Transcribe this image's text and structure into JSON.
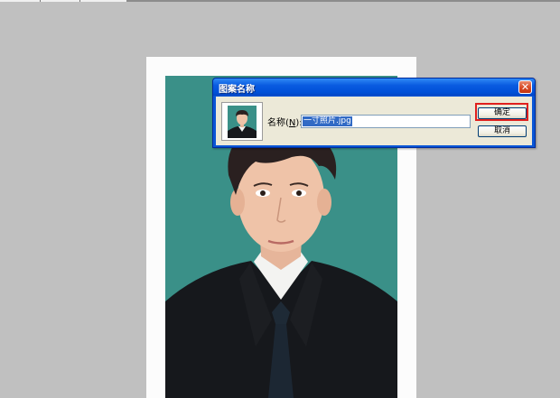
{
  "dialog": {
    "title": "图案名称",
    "close_glyph": "✕",
    "name_label_prefix": "名称(",
    "name_label_accel": "N",
    "name_label_suffix": "):",
    "name_value": "一寸照片.jpg",
    "ok_label": "确定",
    "cancel_label": "取消"
  },
  "colors": {
    "photo_background": "#3a9088",
    "highlight": "#e0201e"
  },
  "icons": [
    "close-icon",
    "pattern-thumbnail"
  ]
}
